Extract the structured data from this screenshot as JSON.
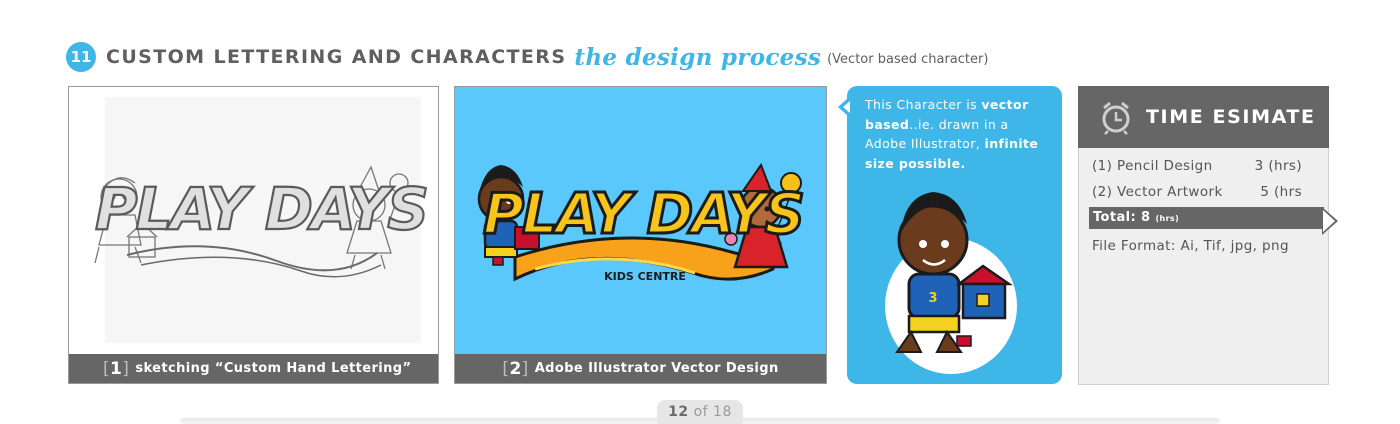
{
  "header": {
    "number": "11",
    "title": "CUSTOM LETTERING AND CHARACTERS",
    "script": "the design process",
    "note": "(Vector based character)"
  },
  "panels": [
    {
      "index": "1",
      "bracket_open": "[",
      "bracket_close": "]",
      "caption": "sketching “Custom Hand Lettering”",
      "logo_text": "PLAY DAYS"
    },
    {
      "index": "2",
      "bracket_open": "[",
      "bracket_close": "]",
      "caption": "Adobe Illustrator Vector Design",
      "logo_text": "PLAY DAYS",
      "logo_sub": "KIDS CENTRE"
    }
  ],
  "note_card": {
    "t1": "This Character is ",
    "b1": "vector based",
    "t2": "..ie. drawn in a Adobe Illustrator, ",
    "b2": "infinite size possible."
  },
  "estimate": {
    "title": "TIME ESIMATE",
    "rows": [
      {
        "label": "(1) Pencil Design",
        "value": "3 (hrs)"
      },
      {
        "label": "(2) Vector Artwork",
        "value": "5 (hrs"
      }
    ],
    "total_label": "Total: 8",
    "total_unit": "(hrs)",
    "format": "File Format: Ai, Tif, jpg, png"
  },
  "pager": {
    "current": "12",
    "of": "of",
    "total": "18"
  },
  "colors": {
    "accent_blue": "#3fb6e8",
    "panel_blue": "#5bc8fb",
    "dark_gray": "#666666",
    "logo_yellow": "#f7c51a"
  }
}
